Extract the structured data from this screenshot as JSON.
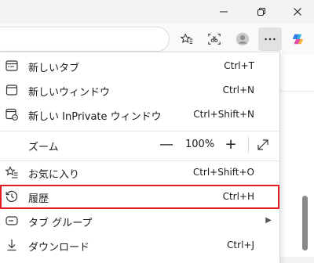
{
  "window": {
    "minimize_icon": "minimize-icon",
    "restore_icon": "restore-icon",
    "close_icon": "close-icon"
  },
  "toolbar": {
    "icons": [
      "favorite-star-icon",
      "screenshot-icon",
      "profile-avatar-icon",
      "more-options-icon",
      "copilot-icon"
    ]
  },
  "menu": {
    "new_tab": {
      "label": "新しいタブ",
      "shortcut": "Ctrl+T"
    },
    "new_window": {
      "label": "新しいウィンドウ",
      "shortcut": "Ctrl+N"
    },
    "new_inprivate": {
      "label": "新しい InPrivate ウィンドウ",
      "shortcut": "Ctrl+Shift+N"
    },
    "zoom": {
      "label": "ズーム",
      "minus": "—",
      "value": "100%",
      "plus": "+"
    },
    "favorites": {
      "label": "お気に入り",
      "shortcut": "Ctrl+Shift+O"
    },
    "history": {
      "label": "履歴",
      "shortcut": "Ctrl+H"
    },
    "tab_groups": {
      "label": "タブ グループ",
      "arrow": "▶"
    },
    "downloads": {
      "label": "ダウンロード",
      "shortcut": "Ctrl+J"
    }
  },
  "colors": {
    "highlight": "#e01b24",
    "copilot_blue": "#2f7de1"
  }
}
